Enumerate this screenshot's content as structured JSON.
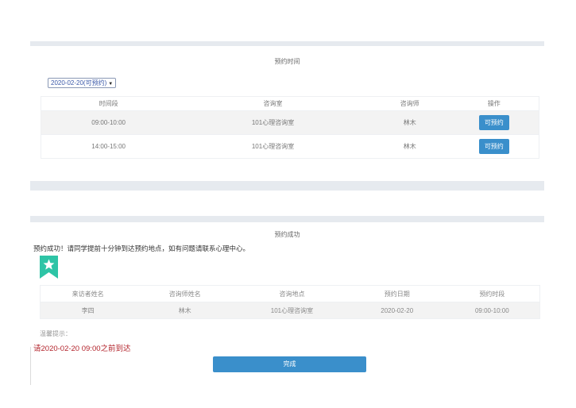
{
  "booking": {
    "title": "预约时间",
    "date_selected": "2020-02-20(可预约)",
    "columns": [
      "时间段",
      "咨询室",
      "咨询师",
      "操作"
    ],
    "rows": [
      {
        "time": "09:00-10:00",
        "room": "101心理咨询室",
        "counselor": "林木",
        "action": "可预约"
      },
      {
        "time": "14:00-15:00",
        "room": "101心理咨询室",
        "counselor": "林木",
        "action": "可预约"
      }
    ]
  },
  "success": {
    "title": "预约成功",
    "message": "预约成功！请同学提前十分钟到达预约地点，如有问题请联系心理中心。",
    "badge_icon": "star-bookmark-icon",
    "badge_color": "#2ec4a6",
    "columns": [
      "来访者姓名",
      "咨询师姓名",
      "咨询地点",
      "预约日期",
      "预约时段"
    ],
    "row": {
      "visitor": "李四",
      "counselor": "林木",
      "location": "101心理咨询室",
      "date": "2020-02-20",
      "slot": "09:00-10:00"
    },
    "tip_label": "温馨提示：",
    "tip_text": "请2020-02-20 09:00之前到达",
    "done_label": "完成"
  },
  "colors": {
    "accent": "#3a8fcb",
    "warning": "#b3242c",
    "strip": "#e6eaef"
  }
}
